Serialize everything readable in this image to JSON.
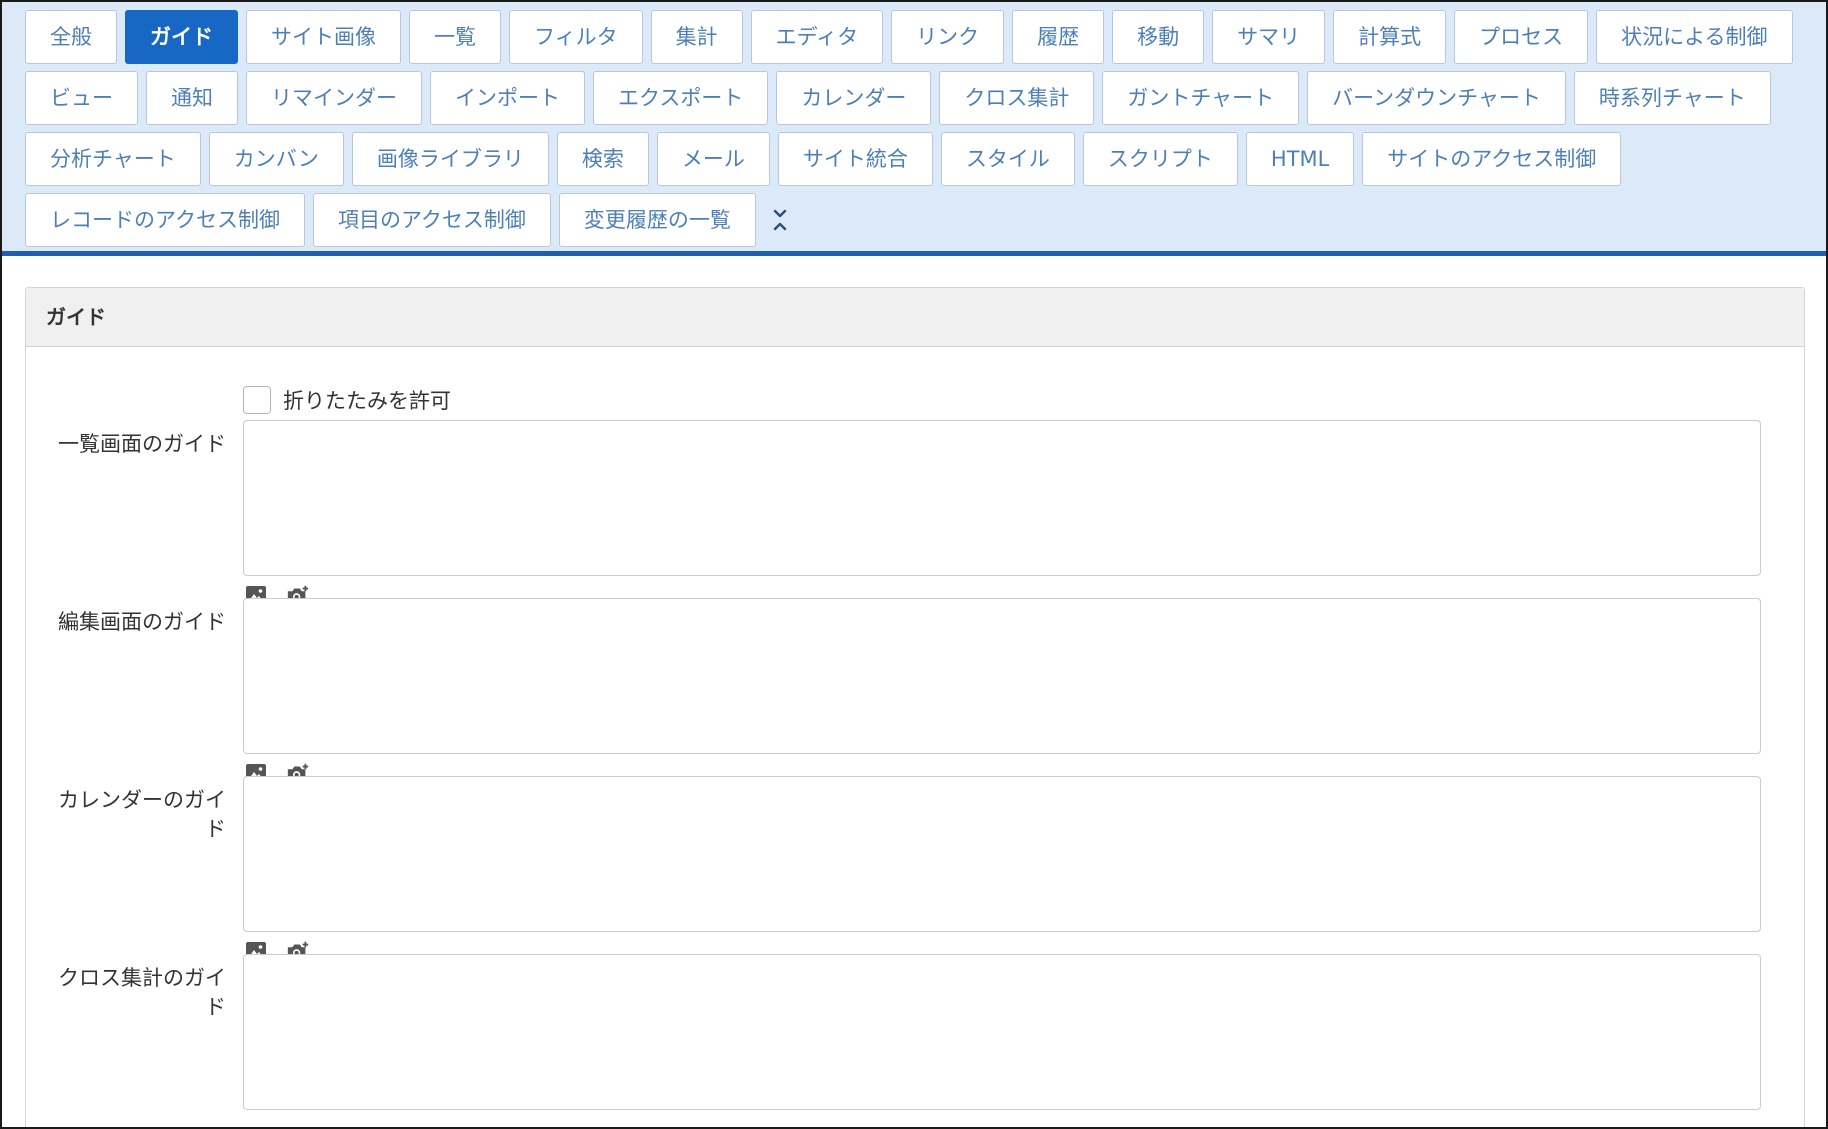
{
  "tabs": {
    "rows": [
      [
        "全般",
        "ガイド",
        "サイト画像",
        "一覧",
        "フィルタ",
        "集計",
        "エディタ",
        "リンク",
        "履歴",
        "移動",
        "サマリ",
        "計算式",
        "プロセス",
        "状況による制御"
      ],
      [
        "ビュー",
        "通知",
        "リマインダー",
        "インポート",
        "エクスポート",
        "カレンダー",
        "クロス集計",
        "ガントチャート",
        "バーンダウンチャート",
        "時系列チャート"
      ],
      [
        "分析チャート",
        "カンバン",
        "画像ライブラリ",
        "検索",
        "メール",
        "サイト統合",
        "スタイル",
        "スクリプト",
        "HTML",
        "サイトのアクセス制御"
      ],
      [
        "レコードのアクセス制御",
        "項目のアクセス制御",
        "変更履歴の一覧"
      ]
    ],
    "active": "ガイド",
    "collapse_icon": "collapse-chevrons-icon",
    "active_color": "#1668c4",
    "tab_text_color": "#4d7fb8",
    "bar_background": "#dce9f8"
  },
  "panel": {
    "title": "ガイド",
    "allow_collapse_label": "折りたたみを許可",
    "allow_collapse_checked": false,
    "fields": [
      {
        "label": "一覧画面のガイド",
        "value": "",
        "icons": [
          "image-icon",
          "camera-icon"
        ]
      },
      {
        "label": "編集画面のガイド",
        "value": "",
        "icons": [
          "image-icon",
          "camera-icon"
        ]
      },
      {
        "label": "カレンダーのガイド",
        "value": "",
        "icons": [
          "image-icon",
          "camera-icon"
        ]
      },
      {
        "label": "クロス集計のガイド",
        "value": "",
        "icons": [
          "image-icon",
          "camera-icon"
        ]
      }
    ]
  }
}
